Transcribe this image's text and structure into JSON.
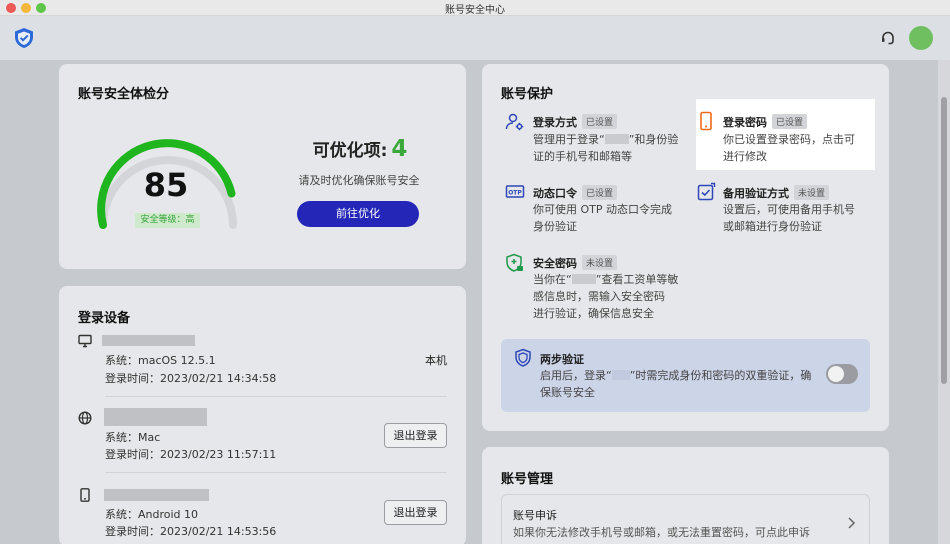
{
  "window": {
    "title": "账号安全中心"
  },
  "score_card": {
    "title": "账号安全体检分",
    "score": "85",
    "level": "安全等级：高",
    "optimize_label": "可优化项:",
    "optimize_count": "4",
    "optimize_hint": "请及时优化确保账号安全",
    "optimize_button": "前往优化"
  },
  "devices": {
    "title": "登录设备",
    "items": [
      {
        "icon": "monitor-icon",
        "system": "系统：macOS 12.5.1",
        "login_time": "登录时间：2023/02/21 14:34:58",
        "tag": "本机"
      },
      {
        "icon": "globe-icon",
        "system": "系统：Mac",
        "login_time": "登录时间：2023/02/23 11:57:11",
        "button": "退出登录"
      },
      {
        "icon": "phone-icon",
        "system": "系统：Android 10",
        "login_time": "登录时间：2023/02/21 14:53:56",
        "button": "退出登录"
      }
    ]
  },
  "protection": {
    "title": "账号保护",
    "login_method": {
      "title": "登录方式",
      "badge": "已设置",
      "desc_1a": "管理用于登录“",
      "desc_1b": "”和身份验",
      "desc_2": "证的手机号和邮箱等"
    },
    "login_password": {
      "title": "登录密码",
      "badge": "已设置",
      "desc_1": "你已设置登录密码，点击可",
      "desc_2": "进行修改"
    },
    "otp": {
      "title": "动态口令",
      "badge": "已设置",
      "desc_1": "你可使用 OTP 动态口令完成",
      "desc_2": "身份验证"
    },
    "backup": {
      "title": "备用验证方式",
      "badge": "未设置",
      "desc_1": "设置后，可使用备用手机号",
      "desc_2": "或邮箱进行身份验证"
    },
    "security_pw": {
      "title": "安全密码",
      "badge": "未设置",
      "desc_1a": "当你在“",
      "desc_1b": "”查看工资单等敏",
      "desc_2": "感信息时，需输入安全密码",
      "desc_3": "进行验证，确保信息安全"
    },
    "two_step": {
      "title": "两步验证",
      "desc_1a": "启用后，登录“",
      "desc_1b": "”时需完成身份和密码的双重验证，确",
      "desc_2": "保账号安全",
      "enabled": false
    }
  },
  "management": {
    "title": "账号管理",
    "appeal_title": "账号申诉",
    "appeal_desc": "如果你无法修改手机号或邮箱，或无法重置密码，可点此申诉"
  },
  "colors": {
    "primary": "#2326b7",
    "success": "#3aa83a",
    "gauge_green": "#1fb51f",
    "highlight": "#ffffff"
  }
}
